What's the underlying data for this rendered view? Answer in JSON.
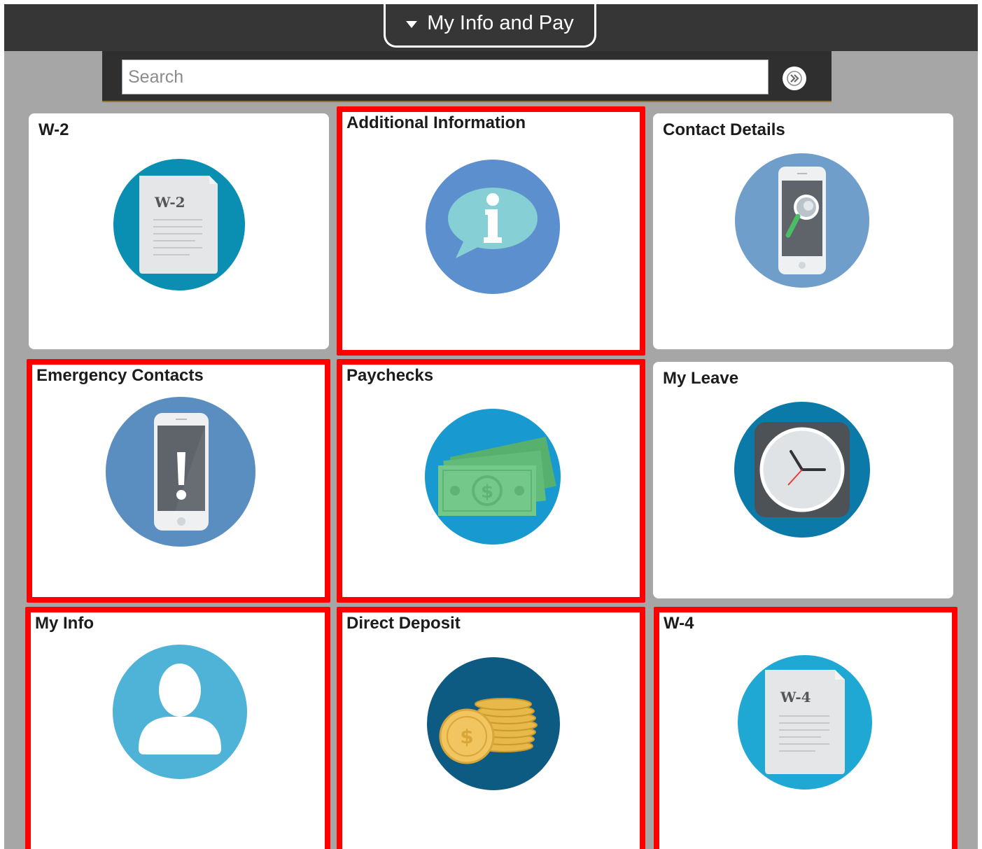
{
  "header": {
    "title": "My Info and Pay",
    "caret_icon": "caret-down-icon"
  },
  "search": {
    "placeholder": "Search",
    "value": "",
    "go_icon": "double-chevron-right-icon"
  },
  "tiles": [
    {
      "label": "W-2",
      "icon": "w2-document-icon",
      "doc_text": "W-2",
      "highlighted": false
    },
    {
      "label": "Additional Information",
      "icon": "info-speech-bubble-icon",
      "highlighted": true
    },
    {
      "label": "Contact Details",
      "icon": "phone-search-icon",
      "highlighted": false
    },
    {
      "label": "Emergency Contacts",
      "icon": "phone-exclamation-icon",
      "highlighted": true
    },
    {
      "label": "Paychecks",
      "icon": "money-bills-icon",
      "highlighted": true
    },
    {
      "label": "My Leave",
      "icon": "clock-icon",
      "highlighted": false
    },
    {
      "label": "My Info",
      "icon": "person-icon",
      "highlighted": true
    },
    {
      "label": "Direct Deposit",
      "icon": "coins-icon",
      "highlighted": true
    },
    {
      "label": "W-4",
      "icon": "w4-document-icon",
      "doc_text": "W-4",
      "highlighted": true
    }
  ],
  "colors": {
    "highlight": "#ff0000",
    "header_bg": "#363636",
    "page_bg": "#a6a6a6"
  }
}
